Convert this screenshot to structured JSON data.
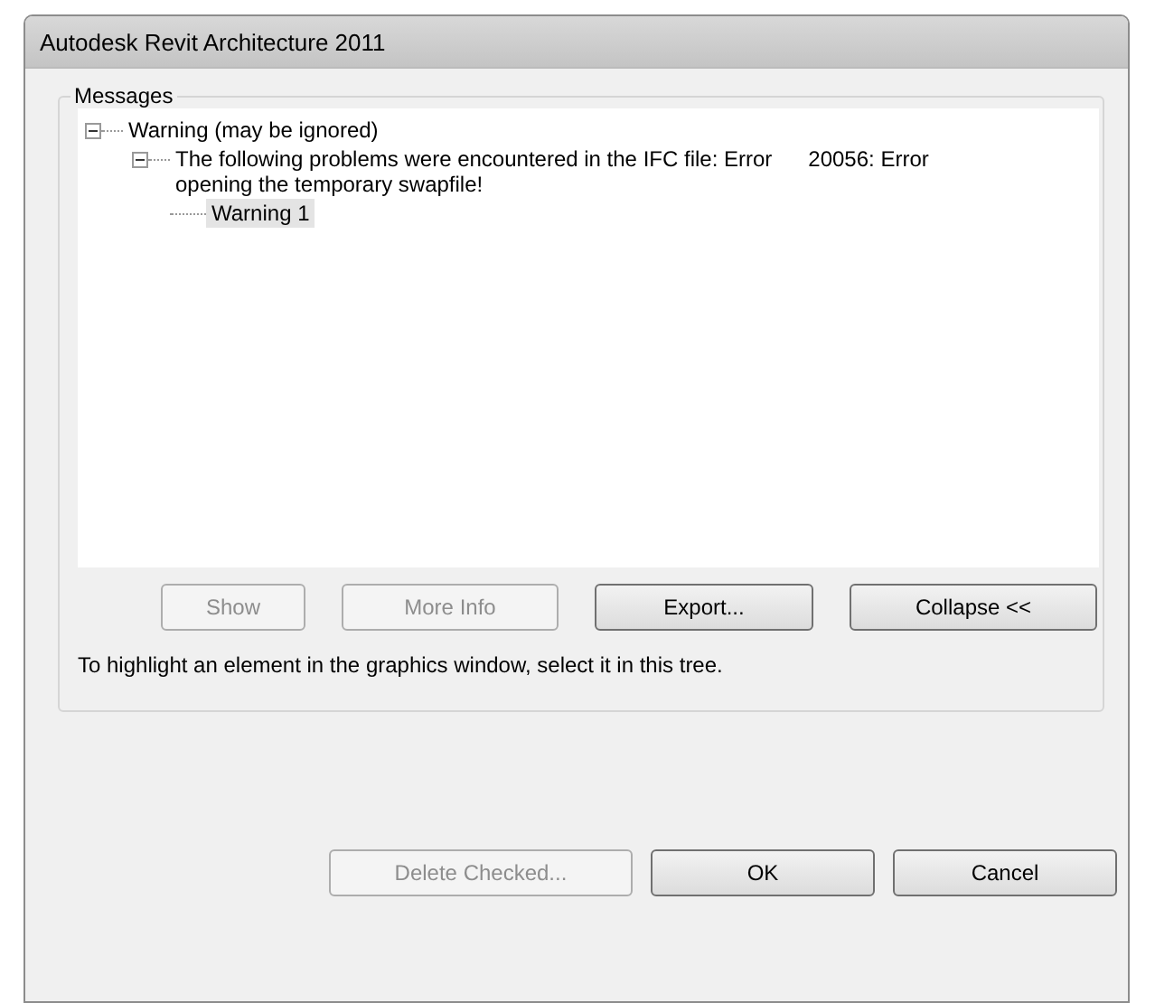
{
  "window": {
    "title": "Autodesk Revit Architecture 2011"
  },
  "messages": {
    "title": "Messages",
    "tree": [
      {
        "label": "Warning (may be ignored)",
        "expanded": true,
        "selected": false,
        "children": [
          {
            "label": "The following problems were encountered in the IFC file: Error      20056: Error opening the temporary swapfile!",
            "expanded": true,
            "selected": false,
            "children": [
              {
                "label": "Warning 1",
                "selected": true
              }
            ]
          }
        ]
      }
    ],
    "buttons": [
      {
        "label": "Show",
        "disabled": true
      },
      {
        "label": "More Info",
        "disabled": true
      },
      {
        "label": "Export...",
        "disabled": false
      },
      {
        "label": "Collapse <<",
        "disabled": false
      }
    ],
    "hint": "To highlight an element in the graphics window, select it in this tree."
  },
  "buttons": [
    {
      "label": "Delete Checked...",
      "disabled": true
    },
    {
      "label": "OK",
      "disabled": false
    },
    {
      "label": "Cancel",
      "disabled": false
    }
  ]
}
